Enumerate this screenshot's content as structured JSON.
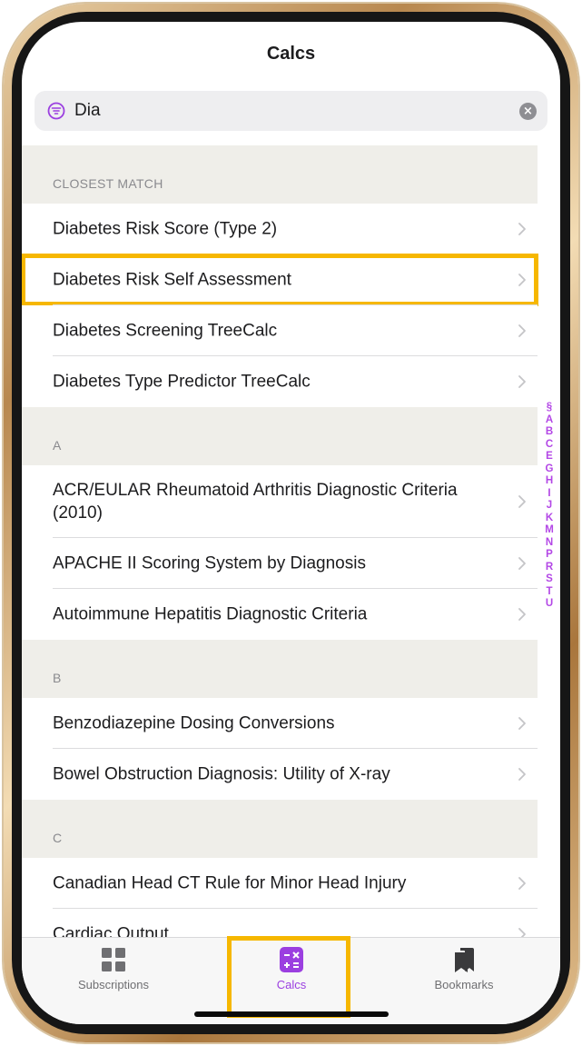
{
  "nav": {
    "title": "Calcs"
  },
  "search": {
    "value": "Dia",
    "filter_icon": "filter-icon",
    "clear_icon": "clear-icon"
  },
  "sections": [
    {
      "header": "CLOSEST MATCH",
      "items": [
        {
          "label": "Diabetes Risk Score (Type 2)"
        },
        {
          "label": "Diabetes Risk Self Assessment",
          "highlighted": true
        },
        {
          "label": "Diabetes Screening TreeCalc"
        },
        {
          "label": "Diabetes Type Predictor TreeCalc"
        }
      ]
    },
    {
      "header": "A",
      "items": [
        {
          "label": "ACR/EULAR Rheumatoid Arthritis Diagnostic Criteria (2010)"
        },
        {
          "label": "APACHE II Scoring System by Diagnosis"
        },
        {
          "label": "Autoimmune Hepatitis Diagnostic Criteria"
        }
      ]
    },
    {
      "header": "B",
      "items": [
        {
          "label": "Benzodiazepine Dosing Conversions"
        },
        {
          "label": "Bowel Obstruction Diagnosis: Utility of X-ray"
        }
      ]
    },
    {
      "header": "C",
      "items": [
        {
          "label": "Canadian Head CT Rule for Minor Head Injury"
        },
        {
          "label": "Cardiac Output"
        }
      ]
    }
  ],
  "index_letters": [
    "§",
    "A",
    "B",
    "C",
    "E",
    "G",
    "H",
    "I",
    "J",
    "K",
    "M",
    "N",
    "P",
    "R",
    "S",
    "T",
    "U"
  ],
  "tabbar": {
    "subscriptions": "Subscriptions",
    "calcs": "Calcs",
    "bookmarks": "Bookmarks"
  },
  "colors": {
    "accent": "#9b3fe0",
    "highlight": "#f6b700",
    "frame": "#b8884f"
  }
}
